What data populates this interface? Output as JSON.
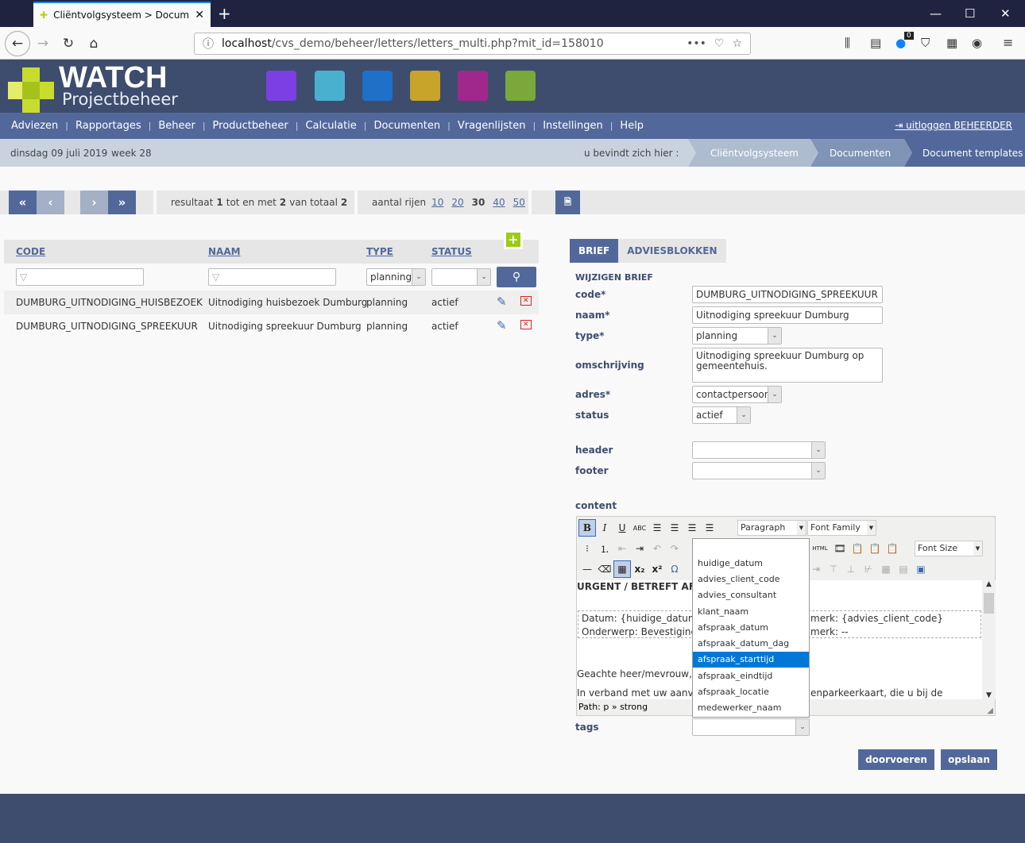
{
  "browser": {
    "tab_title": "Cliëntvolgsysteem > Documen",
    "url_host": "localhost",
    "url_path": "/cvs_demo/beheer/letters/letters_multi.php?mit_id=158010",
    "badge": "0"
  },
  "logo": {
    "title": "WATCH",
    "subtitle": "Projectbeheer"
  },
  "app_icons": [
    {
      "name": "documents",
      "color": "#7b3fe4"
    },
    {
      "name": "clock",
      "color": "#4ab0d0"
    },
    {
      "name": "calendar",
      "color": "#1e70c8"
    },
    {
      "name": "people",
      "color": "#c8a42a"
    },
    {
      "name": "invoice",
      "color": "#a0288c"
    },
    {
      "name": "calculator",
      "color": "#7aa83a"
    }
  ],
  "menu": {
    "items": [
      "Adviezen",
      "Rapportages",
      "Beheer",
      "Productbeheer",
      "Calculatie",
      "Documenten",
      "Vragenlijsten",
      "Instellingen",
      "Help"
    ],
    "logout": "uitloggen BEHEERDER"
  },
  "info": {
    "date": "dinsdag 09 juli 2019",
    "week": "week 28",
    "here": "u bevindt zich hier :"
  },
  "breadcrumb": [
    "Cliëntvolgsysteem",
    "Documenten",
    "Document templates"
  ],
  "pager": {
    "result_prefix": "resultaat",
    "from": "1",
    "mid": "tot en met",
    "to": "2",
    "of": "van totaal",
    "total": "2",
    "rows_label": "aantal rijen",
    "row_options": [
      "10",
      "20",
      "30",
      "40",
      "50"
    ],
    "selected_rows": "30"
  },
  "table": {
    "headers": [
      "CODE",
      "NAAM",
      "TYPE",
      "STATUS"
    ],
    "filter_type": "planning",
    "rows": [
      {
        "code": "DUMBURG_UITNODIGING_HUISBEZOEK",
        "naam": "Uitnodiging huisbezoek Dumburg",
        "type": "planning",
        "status": "actief"
      },
      {
        "code": "DUMBURG_UITNODIGING_SPREEKUUR",
        "naam": "Uitnodiging spreekuur Dumburg",
        "type": "planning",
        "status": "actief"
      }
    ]
  },
  "form": {
    "tabs": [
      "BRIEF",
      "ADVIESBLOKKEN"
    ],
    "title": "WIJZIGEN BRIEF",
    "labels": {
      "code": "code*",
      "naam": "naam*",
      "type": "type*",
      "omschrijving": "omschrijving",
      "adres": "adres*",
      "status": "status",
      "header": "header",
      "footer": "footer",
      "content": "content",
      "tags": "tags"
    },
    "values": {
      "code": "DUMBURG_UITNODIGING_SPREEKUUR",
      "naam": "Uitnodiging spreekuur Dumburg",
      "type": "planning",
      "omschrijving": "Uitnodiging spreekuur Dumburg op gemeentehuis.",
      "adres": "contactpersoon",
      "status": "actief",
      "header": "",
      "footer": "",
      "tags": ""
    },
    "buttons": {
      "submit": "doorvoeren",
      "save": "opslaan"
    }
  },
  "editor": {
    "format": "Paragraph",
    "font_family": "Font Family",
    "font_size": "Font Size",
    "html_label": "HTML",
    "content": {
      "heading": "URGENT / BETREFT AF",
      "line1a": "Datum: {huidige_datum",
      "line1b": "merk: {advies_client_code}",
      "line2a": "Onderwerp: Bevestiging",
      "line2b": "merk: --",
      "greeting": "Geachte heer/mevrouw,",
      "para_a": "In verband met uw aanvr",
      "para_b": "enparkeerkaart, die u bij de"
    },
    "path": "Path: p » strong"
  },
  "tags_dropdown": {
    "options": [
      "huidige_datum",
      "advies_client_code",
      "advies_consultant",
      "klant_naam",
      "afspraak_datum",
      "afspraak_datum_dag",
      "afspraak_starttijd",
      "afspraak_eindtijd",
      "afspraak_locatie",
      "medewerker_naam"
    ],
    "highlighted": "afspraak_starttijd"
  }
}
